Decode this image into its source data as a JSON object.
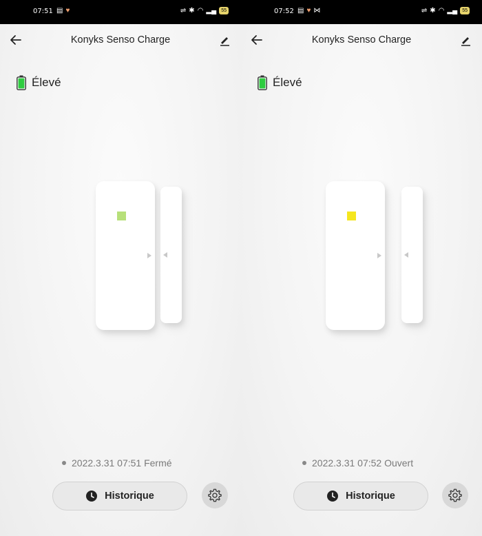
{
  "screens": [
    {
      "status": {
        "time": "07:51",
        "battery": "55"
      },
      "header": {
        "title": "Konyks Senso Charge"
      },
      "battery_level": "Élevé",
      "device": {
        "led_color": "#b7e07a",
        "state": "closed"
      },
      "event": {
        "text": "2022.3.31 07:51 Fermé"
      },
      "history_button": {
        "label": "Historique"
      }
    },
    {
      "status": {
        "time": "07:52",
        "battery": "55"
      },
      "header": {
        "title": "Konyks Senso Charge"
      },
      "battery_level": "Élevé",
      "device": {
        "led_color": "#f5e61e",
        "state": "open"
      },
      "event": {
        "text": "2022.3.31 07:52 Ouvert"
      },
      "history_button": {
        "label": "Historique"
      }
    }
  ],
  "icons": {
    "back": "arrow-left-icon",
    "edit": "pencil-icon",
    "battery": "battery-full-icon",
    "history": "clock-icon",
    "settings": "gear-icon"
  },
  "colors": {
    "battery_green": "#2ecc40",
    "background": "#f4f4f4"
  }
}
